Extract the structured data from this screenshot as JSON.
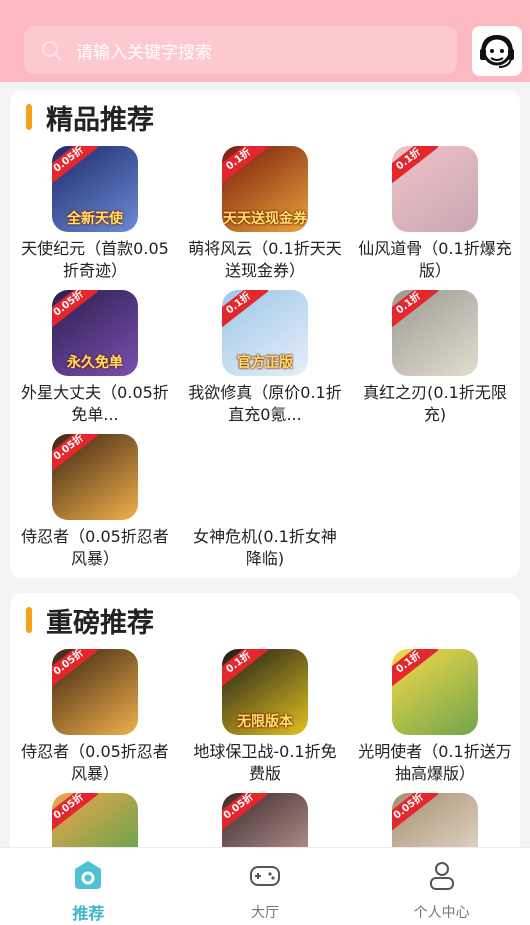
{
  "search": {
    "placeholder": "请输入关键字搜索"
  },
  "sections": [
    {
      "title": "精品推荐",
      "games": [
        {
          "name": "天使纪元（首款0.05折奇迹）",
          "badge": "0.05折",
          "caption": "全新天使",
          "bg": [
            "#1d2a6b",
            "#6c8bd6"
          ]
        },
        {
          "name": "萌将风云（0.1折天天送现金券）",
          "badge": "0.1折",
          "caption": "天天送现金券",
          "bg": [
            "#7a1a0e",
            "#e8a43a"
          ]
        },
        {
          "name": "仙风道骨（0.1折爆充版）",
          "badge": "0.1折",
          "caption": "",
          "bg": [
            "#f0c3c8",
            "#c9a6b2"
          ]
        },
        {
          "name": "外星大丈夫（0.05折免单...",
          "badge": "0.05折",
          "caption": "永久免单",
          "bg": [
            "#2a1f4e",
            "#7b4fb0"
          ]
        },
        {
          "name": "我欲修真（原价0.1折直充0氪...",
          "badge": "0.1折",
          "caption": "官方正版",
          "bg": [
            "#9cc7e8",
            "#e6eef8"
          ]
        },
        {
          "name": "真红之刃(0.1折无限充)",
          "badge": "0.1折",
          "caption": "",
          "bg": [
            "#9b9a92",
            "#e3ddd0"
          ]
        },
        {
          "name": "侍忍者（0.05折忍者风暴）",
          "badge": "0.05折",
          "caption": "",
          "bg": [
            "#3a2412",
            "#f2b04c"
          ]
        },
        {
          "name": "女神危机(0.1折女神降临)",
          "badge": "",
          "caption": "",
          "bg": [
            "#ffffff",
            "#ffffff"
          ]
        }
      ]
    },
    {
      "title": "重磅推荐",
      "games": [
        {
          "name": "侍忍者（0.05折忍者风暴）",
          "badge": "0.05折",
          "caption": "",
          "bg": [
            "#3a2412",
            "#f2b04c"
          ]
        },
        {
          "name": "地球保卫战-0.1折免费版",
          "badge": "0.1折",
          "caption": "无限版本",
          "bg": [
            "#1b1b1b",
            "#e2c21e"
          ]
        },
        {
          "name": "光明使者（0.1折送万抽高爆版）",
          "badge": "0.1折",
          "caption": "",
          "bg": [
            "#f6d94a",
            "#6fa54c"
          ]
        },
        {
          "name": "",
          "badge": "0.05折",
          "caption": "",
          "bg": [
            "#f1a64a",
            "#4aa34f"
          ]
        },
        {
          "name": "",
          "badge": "0.05折",
          "caption": "",
          "bg": [
            "#3b2a2a",
            "#c9a4a0"
          ]
        },
        {
          "name": "",
          "badge": "0.05折",
          "caption": "",
          "bg": [
            "#a78f72",
            "#ece2d4"
          ]
        }
      ]
    }
  ],
  "nav": [
    {
      "label": "推荐",
      "icon": "home-icon",
      "active": true
    },
    {
      "label": "大厅",
      "icon": "gamepad-icon",
      "active": false
    },
    {
      "label": "个人中心",
      "icon": "user-icon",
      "active": false
    }
  ],
  "colors": {
    "header": "#fdb9c1",
    "accent": "#3bb6c8",
    "title_bar": "#f5a11a"
  }
}
